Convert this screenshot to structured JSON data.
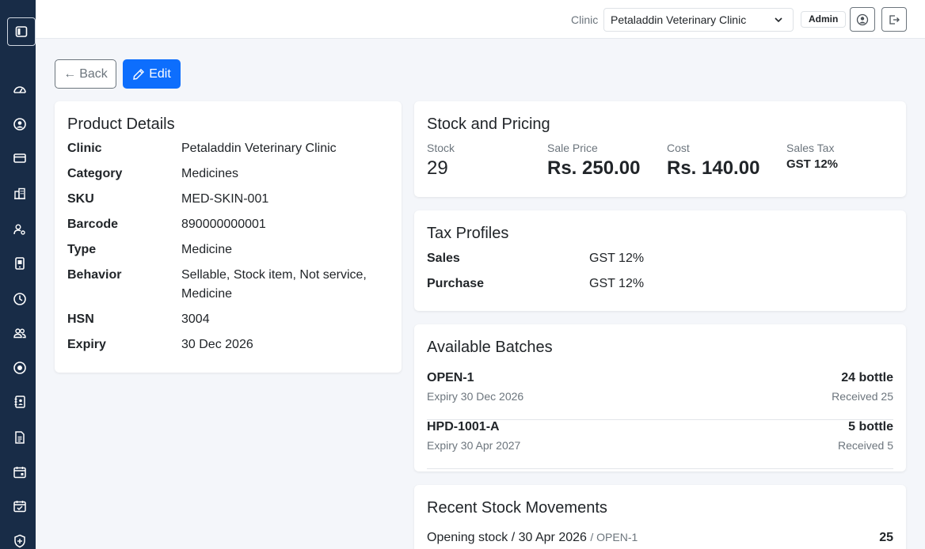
{
  "topbar": {
    "clinic_label": "Clinic",
    "clinic_selected": "Petaladdin Veterinary Clinic",
    "role_badge": "Admin"
  },
  "actions": {
    "back_label": "Back",
    "edit_label": "Edit"
  },
  "product_details": {
    "title": "Product Details",
    "rows": [
      {
        "label": "Clinic",
        "value": "Petaladdin Veterinary Clinic"
      },
      {
        "label": "Category",
        "value": "Medicines"
      },
      {
        "label": "SKU",
        "value": "MED-SKIN-001"
      },
      {
        "label": "Barcode",
        "value": "890000000001"
      },
      {
        "label": "Type",
        "value": "Medicine"
      },
      {
        "label": "Behavior",
        "value": "Sellable, Stock item, Not service, Medicine"
      },
      {
        "label": "HSN",
        "value": "3004"
      },
      {
        "label": "Expiry",
        "value": "30 Dec 2026"
      }
    ]
  },
  "stock_pricing": {
    "title": "Stock and Pricing",
    "stock_label": "Stock",
    "stock_value": "29",
    "sale_price_label": "Sale Price",
    "sale_price_value": "Rs. 250.00",
    "cost_label": "Cost",
    "cost_value": "Rs. 140.00",
    "sales_tax_label": "Sales Tax",
    "sales_tax_value": "GST 12%"
  },
  "tax_profiles": {
    "title": "Tax Profiles",
    "rows": [
      {
        "label": "Sales",
        "value": "GST 12%"
      },
      {
        "label": "Purchase",
        "value": "GST 12%"
      }
    ]
  },
  "batches": {
    "title": "Available Batches",
    "items": [
      {
        "code": "OPEN-1",
        "expiry": "Expiry 30 Dec 2026",
        "qty": "24 bottle",
        "received": "Received 25"
      },
      {
        "code": "HPD-1001-A",
        "expiry": "Expiry 30 Apr 2027",
        "qty": "5 bottle",
        "received": "Received 5"
      }
    ]
  },
  "movements": {
    "title": "Recent Stock Movements",
    "items": [
      {
        "description": "Opening stock / 30 Apr 2026",
        "batch": "/ OPEN-1",
        "qty": "25"
      }
    ]
  },
  "colors": {
    "sidebar": "#182c47",
    "primary": "#0d6efd",
    "background": "#f4f6fa"
  },
  "sidebar_icons": [
    "layout-toggle-icon",
    "dashboard-gauge-icon",
    "user-circle-icon",
    "credit-card-icon",
    "building-icon",
    "user-settings-icon",
    "tablet-icon",
    "clock-icon",
    "users-icon",
    "record-icon",
    "contacts-icon",
    "document-icon",
    "calendar-icon",
    "calendar-check-icon",
    "shield-icon"
  ]
}
